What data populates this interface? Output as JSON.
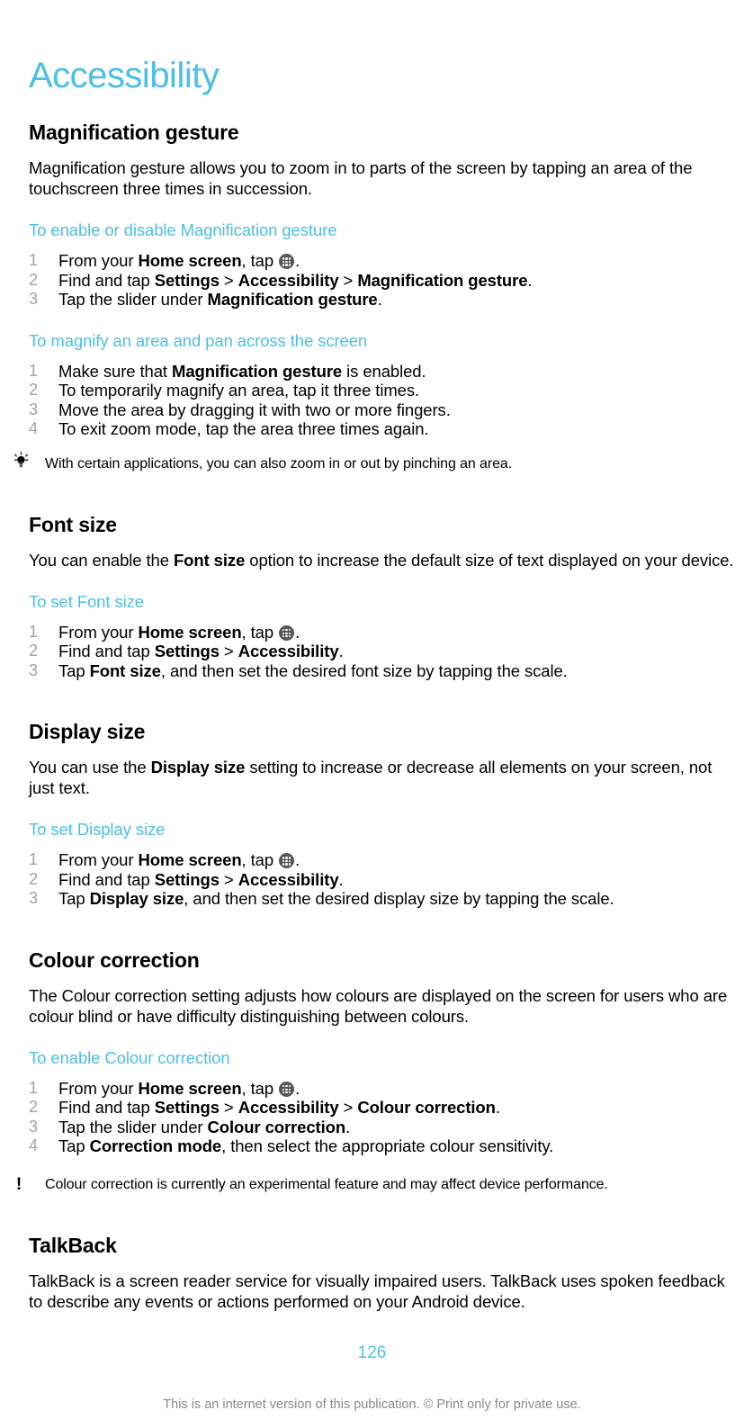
{
  "document": {
    "title": "Accessibility",
    "accent_color": "#4DBEE5",
    "page_number": "126",
    "footer_note": "This is an internet version of this publication. © Print only for private use."
  },
  "sections": [
    {
      "heading": "Magnification gesture",
      "intro": "Magnification gesture allows you to zoom in to parts of the screen by tapping an area of the touchscreen three times in succession.",
      "procedures": [
        {
          "heading": "To enable or disable Magnification gesture",
          "steps": [
            {
              "num": "1",
              "parts": [
                {
                  "t": "From your ",
                  "b": false
                },
                {
                  "t": "Home screen",
                  "b": true
                },
                {
                  "t": ", tap ",
                  "b": false
                },
                {
                  "t": "app-drawer-icon",
                  "icon": true
                },
                {
                  "t": ".",
                  "b": false
                }
              ]
            },
            {
              "num": "2",
              "parts": [
                {
                  "t": "Find and tap ",
                  "b": false
                },
                {
                  "t": "Settings",
                  "b": true
                },
                {
                  "t": " > ",
                  "b": false
                },
                {
                  "t": "Accessibility",
                  "b": true
                },
                {
                  "t": " > ",
                  "b": false
                },
                {
                  "t": "Magnification gesture",
                  "b": true
                },
                {
                  "t": ".",
                  "b": false
                }
              ]
            },
            {
              "num": "3",
              "parts": [
                {
                  "t": "Tap the slider under ",
                  "b": false
                },
                {
                  "t": "Magnification gesture",
                  "b": true
                },
                {
                  "t": ".",
                  "b": false
                }
              ]
            }
          ]
        },
        {
          "heading": "To magnify an area and pan across the screen",
          "steps": [
            {
              "num": "1",
              "parts": [
                {
                  "t": "Make sure that ",
                  "b": false
                },
                {
                  "t": "Magnification gesture",
                  "b": true
                },
                {
                  "t": " is enabled.",
                  "b": false
                }
              ]
            },
            {
              "num": "2",
              "parts": [
                {
                  "t": "To temporarily magnify an area, tap it three times.",
                  "b": false
                }
              ]
            },
            {
              "num": "3",
              "parts": [
                {
                  "t": "Move the area by dragging it with two or more fingers.",
                  "b": false
                }
              ]
            },
            {
              "num": "4",
              "parts": [
                {
                  "t": "To exit zoom mode, tap the area three times again.",
                  "b": false
                }
              ]
            }
          ],
          "note": {
            "type": "tip",
            "icon": "lightbulb-icon",
            "text": "With certain applications, you can also zoom in or out by pinching an area."
          }
        }
      ]
    },
    {
      "heading": "Font size",
      "intro_parts": [
        {
          "t": "You can enable the ",
          "b": false
        },
        {
          "t": "Font size",
          "b": true
        },
        {
          "t": " option to increase the default size of text displayed on your device.",
          "b": false
        }
      ],
      "procedures": [
        {
          "heading": "To set Font size",
          "steps": [
            {
              "num": "1",
              "parts": [
                {
                  "t": "From your ",
                  "b": false
                },
                {
                  "t": "Home screen",
                  "b": true
                },
                {
                  "t": ", tap ",
                  "b": false
                },
                {
                  "t": "app-drawer-icon",
                  "icon": true
                },
                {
                  "t": ".",
                  "b": false
                }
              ]
            },
            {
              "num": "2",
              "parts": [
                {
                  "t": "Find and tap ",
                  "b": false
                },
                {
                  "t": "Settings",
                  "b": true
                },
                {
                  "t": " > ",
                  "b": false
                },
                {
                  "t": "Accessibility",
                  "b": true
                },
                {
                  "t": ".",
                  "b": false
                }
              ]
            },
            {
              "num": "3",
              "parts": [
                {
                  "t": "Tap ",
                  "b": false
                },
                {
                  "t": "Font size",
                  "b": true
                },
                {
                  "t": ", and then set the desired font size by tapping the scale.",
                  "b": false
                }
              ]
            }
          ]
        }
      ]
    },
    {
      "heading": "Display size",
      "intro_parts": [
        {
          "t": "You can use the ",
          "b": false
        },
        {
          "t": "Display size",
          "b": true
        },
        {
          "t": " setting to increase or decrease all elements on your screen, not just text.",
          "b": false
        }
      ],
      "procedures": [
        {
          "heading": "To set Display size",
          "steps": [
            {
              "num": "1",
              "parts": [
                {
                  "t": "From your ",
                  "b": false
                },
                {
                  "t": "Home screen",
                  "b": true
                },
                {
                  "t": ", tap ",
                  "b": false
                },
                {
                  "t": "app-drawer-icon",
                  "icon": true
                },
                {
                  "t": ".",
                  "b": false
                }
              ]
            },
            {
              "num": "2",
              "parts": [
                {
                  "t": "Find and tap ",
                  "b": false
                },
                {
                  "t": "Settings",
                  "b": true
                },
                {
                  "t": " > ",
                  "b": false
                },
                {
                  "t": "Accessibility",
                  "b": true
                },
                {
                  "t": ".",
                  "b": false
                }
              ]
            },
            {
              "num": "3",
              "parts": [
                {
                  "t": "Tap ",
                  "b": false
                },
                {
                  "t": "Display size",
                  "b": true
                },
                {
                  "t": ", and then set the desired display size by tapping the scale.",
                  "b": false
                }
              ]
            }
          ]
        }
      ]
    },
    {
      "heading": "Colour correction",
      "intro": "The Colour correction setting adjusts how colours are displayed on the screen for users who are colour blind or have difficulty distinguishing between colours.",
      "procedures": [
        {
          "heading": "To enable Colour correction",
          "steps": [
            {
              "num": "1",
              "parts": [
                {
                  "t": "From your ",
                  "b": false
                },
                {
                  "t": "Home screen",
                  "b": true
                },
                {
                  "t": ", tap ",
                  "b": false
                },
                {
                  "t": "app-drawer-icon",
                  "icon": true
                },
                {
                  "t": ".",
                  "b": false
                }
              ]
            },
            {
              "num": "2",
              "parts": [
                {
                  "t": "Find and tap ",
                  "b": false
                },
                {
                  "t": "Settings",
                  "b": true
                },
                {
                  "t": " > ",
                  "b": false
                },
                {
                  "t": "Accessibility",
                  "b": true
                },
                {
                  "t": " > ",
                  "b": false
                },
                {
                  "t": "Colour correction",
                  "b": true
                },
                {
                  "t": ".",
                  "b": false
                }
              ]
            },
            {
              "num": "3",
              "parts": [
                {
                  "t": "Tap the slider under ",
                  "b": false
                },
                {
                  "t": "Colour correction",
                  "b": true
                },
                {
                  "t": ".",
                  "b": false
                }
              ]
            },
            {
              "num": "4",
              "parts": [
                {
                  "t": "Tap ",
                  "b": false
                },
                {
                  "t": "Correction mode",
                  "b": true
                },
                {
                  "t": ", then select the appropriate colour sensitivity.",
                  "b": false
                }
              ]
            }
          ],
          "note": {
            "type": "warning",
            "icon": "exclamation-icon",
            "text": "Colour correction is currently an experimental feature and may affect device performance."
          }
        }
      ]
    },
    {
      "heading": "TalkBack",
      "intro": "TalkBack is a screen reader service for visually impaired users. TalkBack uses spoken feedback to describe any events or actions performed on your Android device.",
      "procedures": []
    }
  ]
}
